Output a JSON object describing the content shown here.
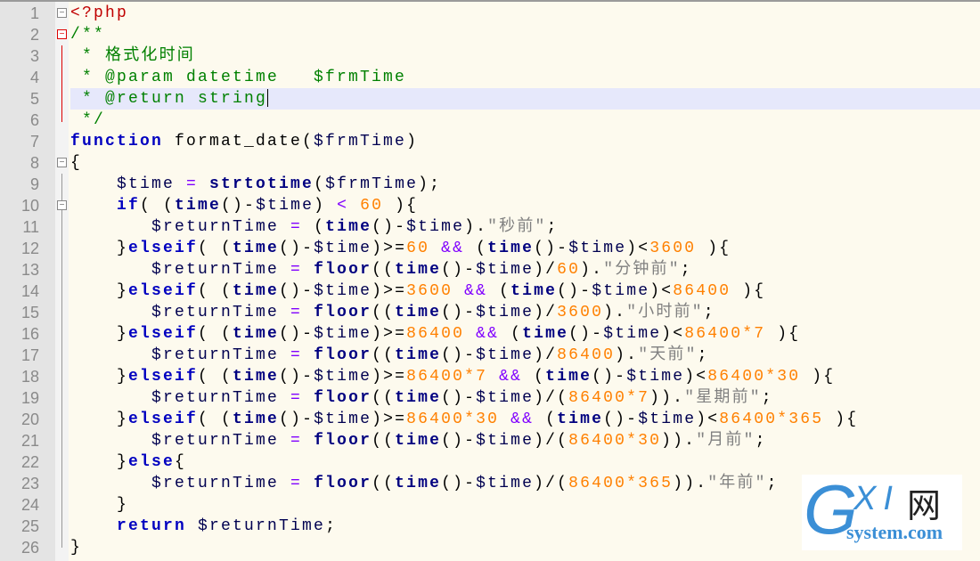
{
  "editor": {
    "current_line": 5,
    "colors": {
      "keyword": "#0000c0",
      "string": "#808080",
      "number": "#ff8000",
      "comment": "#008000",
      "php_tag": "#c00000"
    },
    "lines": [
      [
        [
          "tag",
          "<?php"
        ]
      ],
      [
        [
          "cm",
          "/**"
        ]
      ],
      [
        [
          "cm",
          " * 格式化时间"
        ]
      ],
      [
        [
          "cm",
          " * @param datetime   $frmTime"
        ]
      ],
      [
        [
          "cm",
          " * @return string"
        ]
      ],
      [
        [
          "cm",
          " */"
        ]
      ],
      [
        [
          "kw",
          "function"
        ],
        [
          "id",
          " format_date("
        ],
        [
          "var",
          "$frmTime"
        ],
        [
          "id",
          ")"
        ]
      ],
      [
        [
          "id",
          "{"
        ]
      ],
      [
        [
          "var",
          "    $time"
        ],
        [
          "op",
          " = "
        ],
        [
          "fn",
          "strtotime"
        ],
        [
          "id",
          "("
        ],
        [
          "var",
          "$frmTime"
        ],
        [
          "id",
          ");"
        ]
      ],
      [
        [
          "kw",
          "    if"
        ],
        [
          "id",
          "( ("
        ],
        [
          "fn",
          "time"
        ],
        [
          "id",
          "()-"
        ],
        [
          "var",
          "$time"
        ],
        [
          "id",
          ") "
        ],
        [
          "op",
          "<"
        ],
        [
          "num",
          " 60"
        ],
        [
          "id",
          " ){"
        ]
      ],
      [
        [
          "var",
          "       $returnTime"
        ],
        [
          "op",
          " = "
        ],
        [
          "id",
          "("
        ],
        [
          "fn",
          "time"
        ],
        [
          "id",
          "()-"
        ],
        [
          "var",
          "$time"
        ],
        [
          "id",
          ")."
        ],
        [
          "str",
          "\"秒前\""
        ],
        [
          "id",
          ";"
        ]
      ],
      [
        [
          "id",
          "    }"
        ],
        [
          "kw",
          "elseif"
        ],
        [
          "id",
          "( ("
        ],
        [
          "fn",
          "time"
        ],
        [
          "id",
          "()-"
        ],
        [
          "var",
          "$time"
        ],
        [
          "id",
          ")>="
        ],
        [
          "num",
          "60"
        ],
        [
          "op",
          " && "
        ],
        [
          "id",
          "("
        ],
        [
          "fn",
          "time"
        ],
        [
          "id",
          "()-"
        ],
        [
          "var",
          "$time"
        ],
        [
          "id",
          ")<"
        ],
        [
          "num",
          "3600"
        ],
        [
          "id",
          " ){"
        ]
      ],
      [
        [
          "var",
          "       $returnTime"
        ],
        [
          "op",
          " = "
        ],
        [
          "fn",
          "floor"
        ],
        [
          "id",
          "(("
        ],
        [
          "fn",
          "time"
        ],
        [
          "id",
          "()-"
        ],
        [
          "var",
          "$time"
        ],
        [
          "id",
          ")/"
        ],
        [
          "num",
          "60"
        ],
        [
          "id",
          ")."
        ],
        [
          "str",
          "\"分钟前\""
        ],
        [
          "id",
          ";"
        ]
      ],
      [
        [
          "id",
          "    }"
        ],
        [
          "kw",
          "elseif"
        ],
        [
          "id",
          "( ("
        ],
        [
          "fn",
          "time"
        ],
        [
          "id",
          "()-"
        ],
        [
          "var",
          "$time"
        ],
        [
          "id",
          ")>="
        ],
        [
          "num",
          "3600"
        ],
        [
          "op",
          " && "
        ],
        [
          "id",
          "("
        ],
        [
          "fn",
          "time"
        ],
        [
          "id",
          "()-"
        ],
        [
          "var",
          "$time"
        ],
        [
          "id",
          ")<"
        ],
        [
          "num",
          "86400"
        ],
        [
          "id",
          " ){"
        ]
      ],
      [
        [
          "var",
          "       $returnTime"
        ],
        [
          "op",
          " = "
        ],
        [
          "fn",
          "floor"
        ],
        [
          "id",
          "(("
        ],
        [
          "fn",
          "time"
        ],
        [
          "id",
          "()-"
        ],
        [
          "var",
          "$time"
        ],
        [
          "id",
          ")/"
        ],
        [
          "num",
          "3600"
        ],
        [
          "id",
          ")."
        ],
        [
          "str",
          "\"小时前\""
        ],
        [
          "id",
          ";"
        ]
      ],
      [
        [
          "id",
          "    }"
        ],
        [
          "kw",
          "elseif"
        ],
        [
          "id",
          "( ("
        ],
        [
          "fn",
          "time"
        ],
        [
          "id",
          "()-"
        ],
        [
          "var",
          "$time"
        ],
        [
          "id",
          ")>="
        ],
        [
          "num",
          "86400"
        ],
        [
          "op",
          " && "
        ],
        [
          "id",
          "("
        ],
        [
          "fn",
          "time"
        ],
        [
          "id",
          "()-"
        ],
        [
          "var",
          "$time"
        ],
        [
          "id",
          ")<"
        ],
        [
          "num",
          "86400*7"
        ],
        [
          "id",
          " ){"
        ]
      ],
      [
        [
          "var",
          "       $returnTime"
        ],
        [
          "op",
          " = "
        ],
        [
          "fn",
          "floor"
        ],
        [
          "id",
          "(("
        ],
        [
          "fn",
          "time"
        ],
        [
          "id",
          "()-"
        ],
        [
          "var",
          "$time"
        ],
        [
          "id",
          ")/"
        ],
        [
          "num",
          "86400"
        ],
        [
          "id",
          ")."
        ],
        [
          "str",
          "\"天前\""
        ],
        [
          "id",
          ";"
        ]
      ],
      [
        [
          "id",
          "    }"
        ],
        [
          "kw",
          "elseif"
        ],
        [
          "id",
          "( ("
        ],
        [
          "fn",
          "time"
        ],
        [
          "id",
          "()-"
        ],
        [
          "var",
          "$time"
        ],
        [
          "id",
          ")>="
        ],
        [
          "num",
          "86400*7"
        ],
        [
          "op",
          " && "
        ],
        [
          "id",
          "("
        ],
        [
          "fn",
          "time"
        ],
        [
          "id",
          "()-"
        ],
        [
          "var",
          "$time"
        ],
        [
          "id",
          ")<"
        ],
        [
          "num",
          "86400*30"
        ],
        [
          "id",
          " ){"
        ]
      ],
      [
        [
          "var",
          "       $returnTime"
        ],
        [
          "op",
          " = "
        ],
        [
          "fn",
          "floor"
        ],
        [
          "id",
          "(("
        ],
        [
          "fn",
          "time"
        ],
        [
          "id",
          "()-"
        ],
        [
          "var",
          "$time"
        ],
        [
          "id",
          ")/("
        ],
        [
          "num",
          "86400*7"
        ],
        [
          "id",
          "))."
        ],
        [
          "str",
          "\"星期前\""
        ],
        [
          "id",
          ";"
        ]
      ],
      [
        [
          "id",
          "    }"
        ],
        [
          "kw",
          "elseif"
        ],
        [
          "id",
          "( ("
        ],
        [
          "fn",
          "time"
        ],
        [
          "id",
          "()-"
        ],
        [
          "var",
          "$time"
        ],
        [
          "id",
          ")>="
        ],
        [
          "num",
          "86400*30"
        ],
        [
          "op",
          " && "
        ],
        [
          "id",
          "("
        ],
        [
          "fn",
          "time"
        ],
        [
          "id",
          "()-"
        ],
        [
          "var",
          "$time"
        ],
        [
          "id",
          ")<"
        ],
        [
          "num",
          "86400*365"
        ],
        [
          "id",
          " ){"
        ]
      ],
      [
        [
          "var",
          "       $returnTime"
        ],
        [
          "op",
          " = "
        ],
        [
          "fn",
          "floor"
        ],
        [
          "id",
          "(("
        ],
        [
          "fn",
          "time"
        ],
        [
          "id",
          "()-"
        ],
        [
          "var",
          "$time"
        ],
        [
          "id",
          ")/("
        ],
        [
          "num",
          "86400*30"
        ],
        [
          "id",
          "))."
        ],
        [
          "str",
          "\"月前\""
        ],
        [
          "id",
          ";"
        ]
      ],
      [
        [
          "id",
          "    }"
        ],
        [
          "kw",
          "else"
        ],
        [
          "id",
          "{"
        ]
      ],
      [
        [
          "var",
          "       $returnTime"
        ],
        [
          "op",
          " = "
        ],
        [
          "fn",
          "floor"
        ],
        [
          "id",
          "(("
        ],
        [
          "fn",
          "time"
        ],
        [
          "id",
          "()-"
        ],
        [
          "var",
          "$time"
        ],
        [
          "id",
          ")/("
        ],
        [
          "num",
          "86400*365"
        ],
        [
          "id",
          "))."
        ],
        [
          "str",
          "\"年前\""
        ],
        [
          "id",
          ";"
        ]
      ],
      [
        [
          "id",
          "    }"
        ]
      ],
      [
        [
          "kw",
          "    return"
        ],
        [
          "var",
          " $returnTime"
        ],
        [
          "id",
          ";"
        ]
      ],
      [
        [
          "id",
          "}"
        ]
      ]
    ]
  },
  "watermark": {
    "text": "GXI网 system.com"
  }
}
